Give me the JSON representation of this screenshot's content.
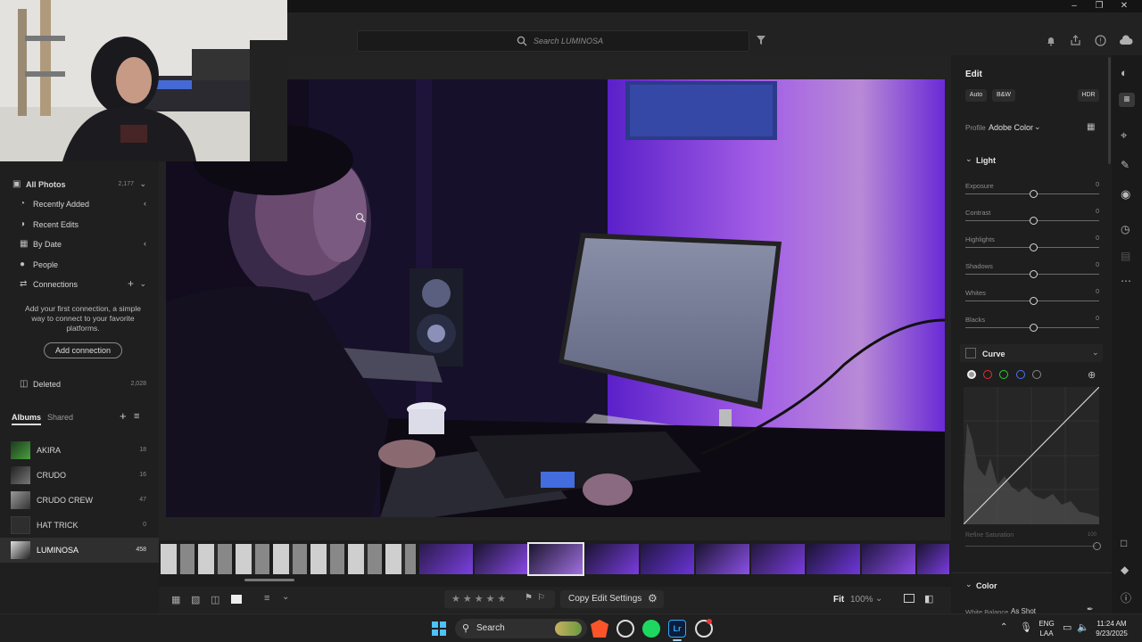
{
  "search": {
    "placeholder": "Search LUMINOSA"
  },
  "sidebar": {
    "nav": [
      {
        "label": "All Photos",
        "count": "2,177"
      },
      {
        "label": "Recently Added"
      },
      {
        "label": "Recent Edits"
      },
      {
        "label": "By Date"
      },
      {
        "label": "People"
      },
      {
        "label": "Connections"
      }
    ],
    "connections_message": "Add your first connection, a simple way to connect to your favorite platforms.",
    "add_connection_label": "Add connection",
    "deleted": {
      "label": "Deleted",
      "count": "2,028"
    },
    "tabs": {
      "albums": "Albums",
      "shared": "Shared"
    },
    "albums": [
      {
        "name": "AKIRA",
        "count": "18"
      },
      {
        "name": "CRUDO",
        "count": "16"
      },
      {
        "name": "CRUDO CREW",
        "count": "47"
      },
      {
        "name": "HAT TRICK",
        "count": "0"
      },
      {
        "name": "LUMINOSA",
        "count": "458"
      }
    ]
  },
  "edit_panel": {
    "title": "Edit",
    "buttons": {
      "auto": "Auto",
      "bw": "B&W",
      "hdr": "HDR"
    },
    "profile_label": "Profile",
    "profile_value": "Adobe Color",
    "light_section": "Light",
    "sliders": [
      {
        "label": "Exposure",
        "value": "0"
      },
      {
        "label": "Contrast",
        "value": "0"
      },
      {
        "label": "Highlights",
        "value": "0"
      },
      {
        "label": "Shadows",
        "value": "0"
      },
      {
        "label": "Whites",
        "value": "0"
      },
      {
        "label": "Blacks",
        "value": "0"
      }
    ],
    "curve_section": "Curve",
    "refine_saturation_label": "Refine Saturation",
    "refine_saturation_value": "100",
    "color_section": "Color",
    "white_balance_label": "White Balance",
    "white_balance_value": "As Shot"
  },
  "bottombar": {
    "copy_edit_settings": "Copy Edit Settings",
    "fit_label": "Fit",
    "zoom_value": "100%"
  },
  "taskbar": {
    "search_label": "Search",
    "lang_top": "ENG",
    "lang_bottom": "LAA",
    "time": "11:24 AM",
    "date": "9/23/2025"
  },
  "colors": {
    "accent_purple": "#7a3cff",
    "panel_bg": "#1e1e1e",
    "spotify": "#1ed760",
    "brave": "#fb542b"
  }
}
